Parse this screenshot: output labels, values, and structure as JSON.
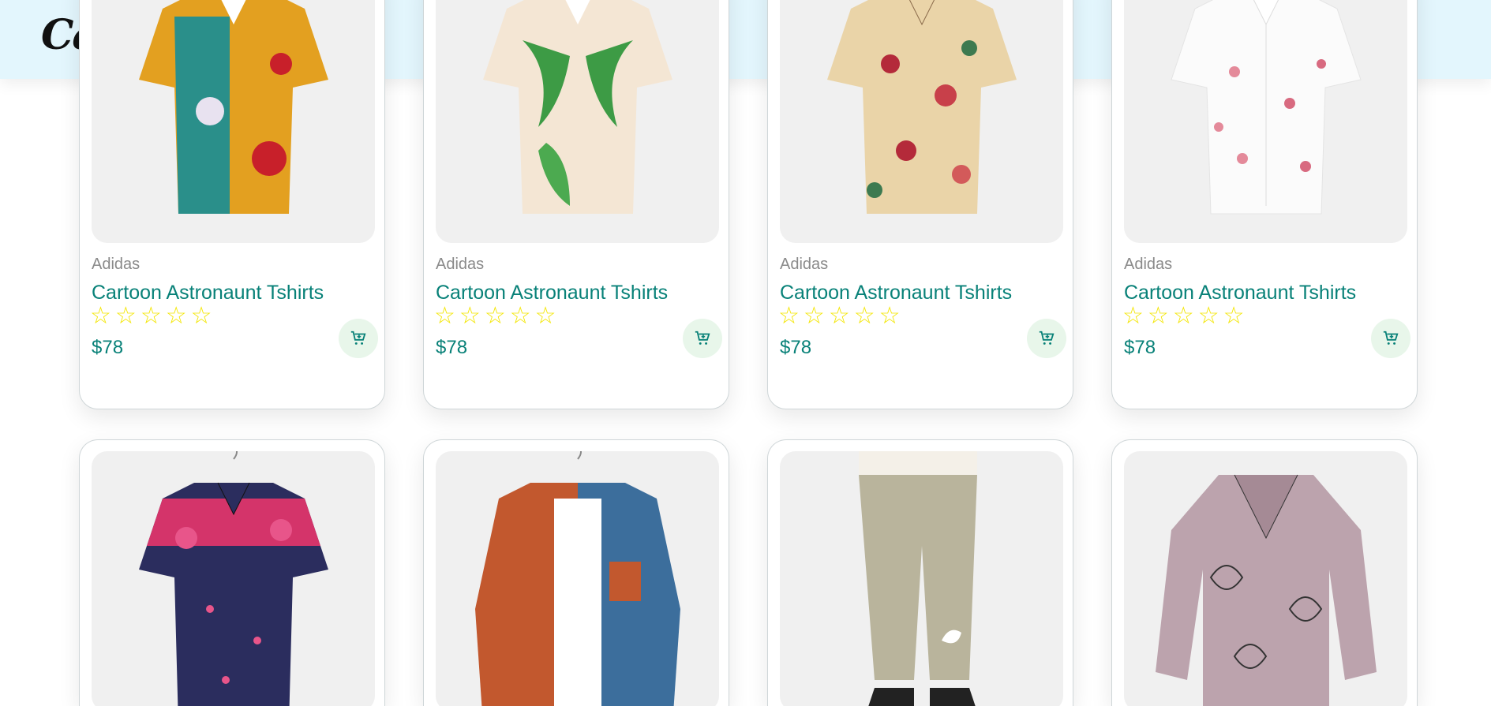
{
  "header": {
    "logo_text": "Ca",
    "logo_text_right": "/"
  },
  "products": [
    {
      "brand": "Adidas",
      "name": "Cartoon Astronaunt Tshirts",
      "price": "$78",
      "rating": 5,
      "image_icon": "shirt-icon"
    },
    {
      "brand": "Adidas",
      "name": "Cartoon Astronaunt Tshirts",
      "price": "$78",
      "rating": 5,
      "image_icon": "shirt-icon"
    },
    {
      "brand": "Adidas",
      "name": "Cartoon Astronaunt Tshirts",
      "price": "$78",
      "rating": 5,
      "image_icon": "shirt-icon"
    },
    {
      "brand": "Adidas",
      "name": "Cartoon Astronaunt Tshirts",
      "price": "$78",
      "rating": 5,
      "image_icon": "shirt-icon"
    },
    {
      "image_icon": "shirt-icon"
    },
    {
      "image_icon": "jacket-icon"
    },
    {
      "image_icon": "pants-icon"
    },
    {
      "image_icon": "blouse-icon"
    }
  ],
  "theme": {
    "accent": "#088178",
    "star": "#f3e600",
    "header_bg": "#e3f6fd",
    "cart_bg": "#e8f6ea"
  }
}
